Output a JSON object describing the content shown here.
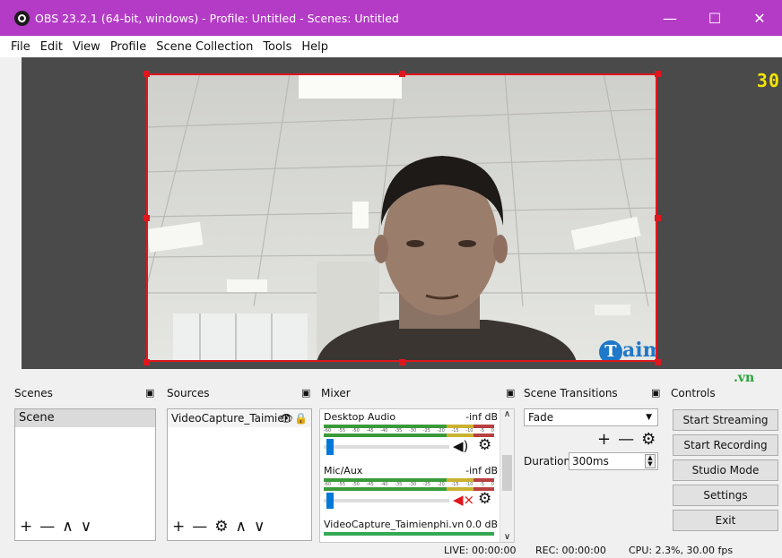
{
  "window": {
    "title": "OBS 23.2.1 (64-bit, windows) - Profile: Untitled - Scenes: Untitled",
    "minimize": "—",
    "maximize": "☐",
    "close": "✕"
  },
  "menu": [
    "File",
    "Edit",
    "View",
    "Profile",
    "Scene Collection",
    "Tools",
    "Help"
  ],
  "preview": {
    "fps_indicator": "30",
    "watermark_letter": "T",
    "watermark_text": "aimienphi",
    "watermark_suffix": ".vn"
  },
  "scenes": {
    "title": "Scenes",
    "items": [
      "Scene"
    ],
    "toolbar": [
      "+",
      "—",
      "∧",
      "∨"
    ]
  },
  "sources": {
    "title": "Sources",
    "items": [
      "VideoCapture_Taimien"
    ],
    "toolbar": [
      "+",
      "—",
      "⚙",
      "∧",
      "∨"
    ]
  },
  "mixer": {
    "title": "Mixer",
    "channels": [
      {
        "name": "Desktop Audio",
        "level": "-inf dB",
        "muted": false,
        "volume": 0.02
      },
      {
        "name": "Mic/Aux",
        "level": "-inf dB",
        "muted": true,
        "volume": 0.02
      },
      {
        "name": "VideoCapture_Taimienphi.vn",
        "level": "0.0 dB",
        "muted": false,
        "volume": 1.0
      }
    ],
    "scale": [
      "-60",
      "-55",
      "-50",
      "-45",
      "-40",
      "-35",
      "-30",
      "-25",
      "-20",
      "-15",
      "-10",
      "-5",
      "0"
    ]
  },
  "transitions": {
    "title": "Scene Transitions",
    "selected": "Fade",
    "duration_label": "Duration",
    "duration_value": "300ms",
    "toolbar": [
      "+",
      "—",
      "⚙"
    ]
  },
  "controls": {
    "title": "Controls",
    "buttons": [
      "Start Streaming",
      "Start Recording",
      "Studio Mode",
      "Settings",
      "Exit"
    ]
  },
  "status": {
    "live": "LIVE: 00:00:00",
    "rec": "REC: 00:00:00",
    "cpu": "CPU: 2.3%, 30.00 fps"
  },
  "colors": {
    "titlebar": "#b43bc6",
    "selection": "#e0161d",
    "fps": "#f2e400",
    "meter_green": "#34a853",
    "slider_blue": "#0078d7"
  }
}
